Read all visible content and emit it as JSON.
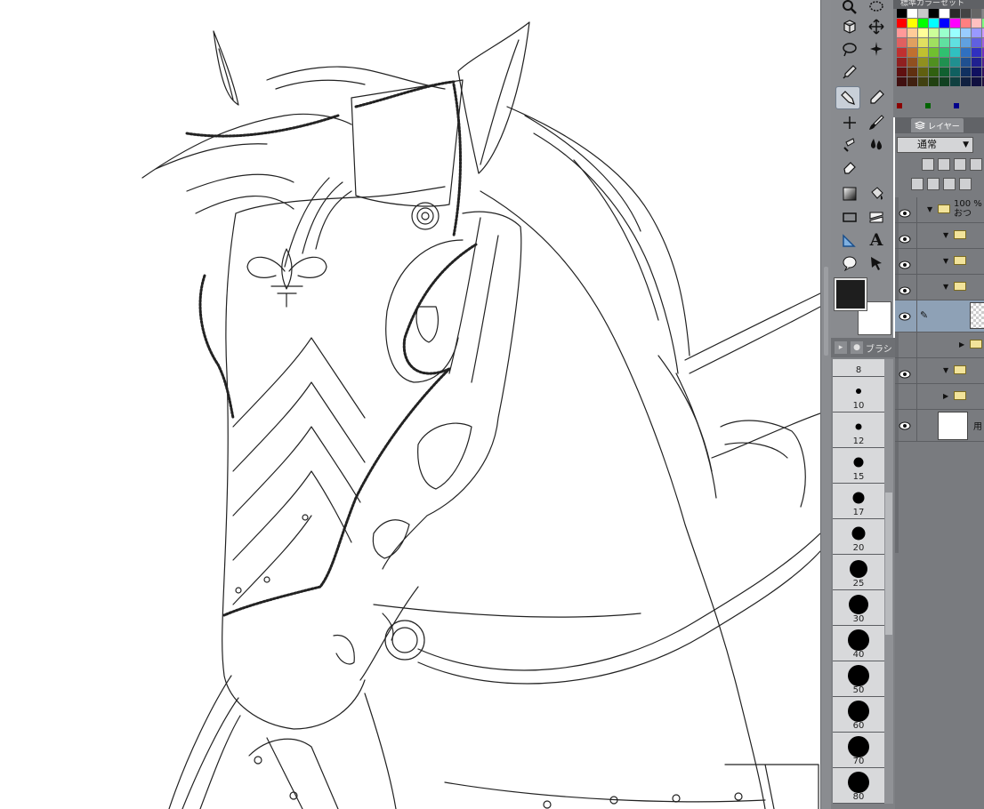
{
  "color_set": {
    "tab_label": "標準カラーセット",
    "swatches": [
      "#000000",
      "#ffffff",
      "#c8c8c8",
      "#000000",
      "#ffffff",
      "#2a2a2a",
      "#444444",
      "#666666",
      "#888888",
      "#aaaaaa",
      "#cccccc",
      "#ff0000",
      "#ffff00",
      "#00ff00",
      "#00ffff",
      "#0000ff",
      "#ff00ff",
      "#ff8080",
      "#ffc0c0",
      "#80ff80",
      "#c0ffff",
      "#8080ff",
      "#ff9999",
      "#ffcc99",
      "#ffff99",
      "#ccff99",
      "#99ffcc",
      "#99ffff",
      "#99ccff",
      "#9999ff",
      "#cc99ff",
      "#ff99ff",
      "#ff99cc",
      "#e06060",
      "#e0a060",
      "#e0e060",
      "#a0e060",
      "#60e0a0",
      "#60e0e0",
      "#60a0e0",
      "#6060e0",
      "#a060e0",
      "#e060e0",
      "#e060a0",
      "#c03030",
      "#c07030",
      "#c0c030",
      "#70c030",
      "#30c070",
      "#30c0c0",
      "#3070c0",
      "#3030c0",
      "#7030c0",
      "#c030c0",
      "#c03070",
      "#902020",
      "#905020",
      "#909020",
      "#509020",
      "#209050",
      "#209090",
      "#205090",
      "#202090",
      "#502090",
      "#902090",
      "#902050",
      "#601010",
      "#603010",
      "#606010",
      "#306010",
      "#106030",
      "#106060",
      "#103060",
      "#101060",
      "#301060",
      "#601060",
      "#601030",
      "#401010",
      "#402010",
      "#404010",
      "#204010",
      "#104020",
      "#104040",
      "#102040",
      "#101040",
      "#201040",
      "#401040",
      "#401020"
    ],
    "mini_swatches": [
      "#8b0000",
      "#006400",
      "#00008b"
    ]
  },
  "tools": [
    {
      "name": "zoom-tool",
      "icon": "magnifier-icon"
    },
    {
      "name": "selection-tool",
      "icon": "lasso-icon"
    },
    {
      "name": "object-tool",
      "icon": "cube-icon"
    },
    {
      "name": "move-tool",
      "icon": "move-arrows-icon"
    },
    {
      "name": "lasso-tool",
      "icon": "lasso-icon"
    },
    {
      "name": "auto-select-tool",
      "icon": "magic-wand-icon"
    },
    {
      "name": "eyedropper-tool",
      "icon": "eyedropper-icon"
    },
    {
      "name": "pen-tool",
      "icon": "pen-icon"
    },
    {
      "name": "pencil-tool",
      "icon": "pencil-icon"
    },
    {
      "name": "airbrush-tool",
      "icon": "sparkle-icon"
    },
    {
      "name": "brush-tool",
      "icon": "brush-icon"
    },
    {
      "name": "decoration-tool",
      "icon": "spray-icon"
    },
    {
      "name": "blend-tool",
      "icon": "droplet-icon"
    },
    {
      "name": "eraser-tool",
      "icon": "eraser-icon"
    },
    {
      "name": "gradient-tool",
      "icon": "gradient-icon"
    },
    {
      "name": "fill-tool",
      "icon": "bucket-icon"
    },
    {
      "name": "figure-tool",
      "icon": "rectangle-icon"
    },
    {
      "name": "frame-tool",
      "icon": "frame-icon"
    },
    {
      "name": "ruler-tool",
      "icon": "ruler-icon"
    },
    {
      "name": "text-tool",
      "icon": "text-A-icon",
      "glyph": "A"
    },
    {
      "name": "balloon-tool",
      "icon": "speech-balloon-icon"
    },
    {
      "name": "correct-line-tool",
      "icon": "arrow-cursor-icon"
    }
  ],
  "colors": {
    "main": "#1e1e1e",
    "sub": "#ffffff",
    "panel": "#7f8185",
    "accent": "#8ea1b6"
  },
  "brush_panel": {
    "tab_label": "ブラシ",
    "sizes": [
      {
        "label": "8",
        "dot": 0
      },
      {
        "label": "10",
        "dot": 6
      },
      {
        "label": "12",
        "dot": 7
      },
      {
        "label": "15",
        "dot": 11
      },
      {
        "label": "17",
        "dot": 13
      },
      {
        "label": "20",
        "dot": 15
      },
      {
        "label": "25",
        "dot": 20
      },
      {
        "label": "30",
        "dot": 22
      },
      {
        "label": "40",
        "dot": 24
      },
      {
        "label": "50",
        "dot": 24
      },
      {
        "label": "60",
        "dot": 24
      },
      {
        "label": "70",
        "dot": 24
      },
      {
        "label": "80",
        "dot": 24
      }
    ]
  },
  "layer_panel": {
    "tab_label": "レイヤー",
    "blend_mode": "通常",
    "layers": [
      {
        "type": "folder",
        "indent": 0,
        "label": "100 %\nおつ",
        "visible": true
      },
      {
        "type": "folder",
        "indent": 1,
        "label": "",
        "visible": true
      },
      {
        "type": "folder",
        "indent": 1,
        "label": "",
        "visible": true
      },
      {
        "type": "folder",
        "indent": 1,
        "label": "",
        "visible": true
      },
      {
        "type": "raster",
        "indent": 2,
        "label": "",
        "visible": true,
        "selected": true
      },
      {
        "type": "folder-collapsed",
        "indent": 2,
        "label": "",
        "visible": false
      },
      {
        "type": "folder",
        "indent": 1,
        "label": "",
        "visible": true
      },
      {
        "type": "folder-collapsed",
        "indent": 1,
        "label": "",
        "visible": false
      },
      {
        "type": "paper",
        "indent": 0,
        "label": "用",
        "visible": true
      }
    ]
  }
}
